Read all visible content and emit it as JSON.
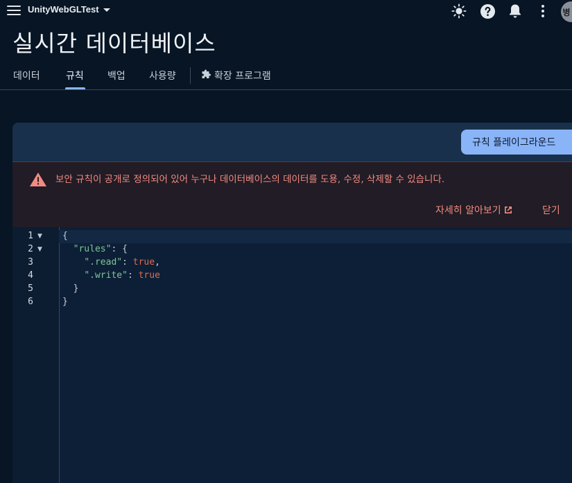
{
  "header": {
    "project_name": "UnityWebGLTest",
    "avatar_initial": "병"
  },
  "page": {
    "title": "실시간 데이터베이스"
  },
  "tabs": [
    {
      "label": "데이터"
    },
    {
      "label": "규칙"
    },
    {
      "label": "백업"
    },
    {
      "label": "사용량"
    },
    {
      "label": "확장 프로그램"
    }
  ],
  "toolbar": {
    "playground_label": "규칙 플레이그라운드"
  },
  "warning": {
    "message": "보안 규칙이 공개로 정의되어 있어 누구나 데이터베이스의 데이터를 도용, 수정, 삭제할 수 있습니다.",
    "learn_more_label": "자세히 알아보기",
    "close_label": "닫기"
  },
  "editor": {
    "line_numbers": [
      "1",
      "2",
      "3",
      "4",
      "5",
      "6"
    ],
    "lines": {
      "l1_open": "{",
      "l2_key": "\"rules\"",
      "l2_rest": ": {",
      "l3_key": "\".read\"",
      "l3_colon": ": ",
      "l3_val": "true",
      "l3_comma": ",",
      "l4_key": "\".write\"",
      "l4_colon": ": ",
      "l4_val": "true",
      "l5_close": "}",
      "l6_close": "}"
    }
  },
  "colors": {
    "accent": "#8ab4f8",
    "warning_text": "#f28b82",
    "json_key": "#7ec699",
    "json_bool": "#e06c4f"
  }
}
